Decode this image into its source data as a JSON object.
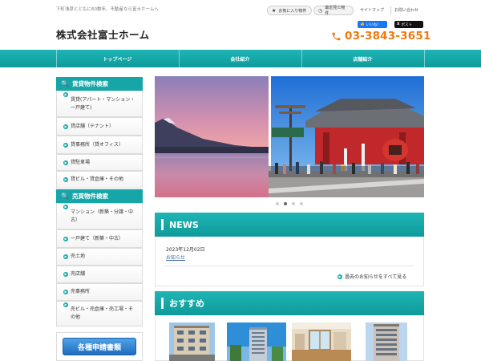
{
  "header": {
    "tagline": "下町浅草とともに60数年、不動産なら富士ホームへ",
    "site_title": "株式会社富士ホーム",
    "favorites_label": "お気に入り物件",
    "recent_label": "最近見た物件",
    "sitemap_label": "サイトマップ",
    "contact_label": "お問い合わせ",
    "fb_label": "いいね！",
    "tw_label": "ポスト",
    "phone": "03-3843-3651"
  },
  "nav": {
    "items": [
      "トップページ",
      "会社紹介",
      "店舗紹介"
    ]
  },
  "sidebar": {
    "rent_heading": "賃貸物件検索",
    "rent_items": [
      "賃貸(アパート・マンション・一戸建て)",
      "貸店舗（テナント）",
      "貸事務所（貸オフィス）",
      "貸駐車場",
      "貸ビル・貸倉庫・その他"
    ],
    "sale_heading": "売買物件検索",
    "sale_items": [
      "マンション（新築・分譲・中古）",
      "一戸建て（新築・中古）",
      "売土地",
      "売店舗",
      "売事務所",
      "売ビル・売倉庫・売工場・その他"
    ],
    "banner_label": "各種申請書類"
  },
  "slider": {
    "dot_count": 4,
    "active_dot": 1
  },
  "news": {
    "heading": "NEWS",
    "date": "2023年12月02日",
    "title": "お知らせ",
    "more_label": "過去のお知らせをすべて見る"
  },
  "recommend": {
    "heading": "おすすめ"
  },
  "colors": {
    "teal": "#16a6a7",
    "orange": "#ee7a10",
    "link_blue": "#3a66b0"
  }
}
